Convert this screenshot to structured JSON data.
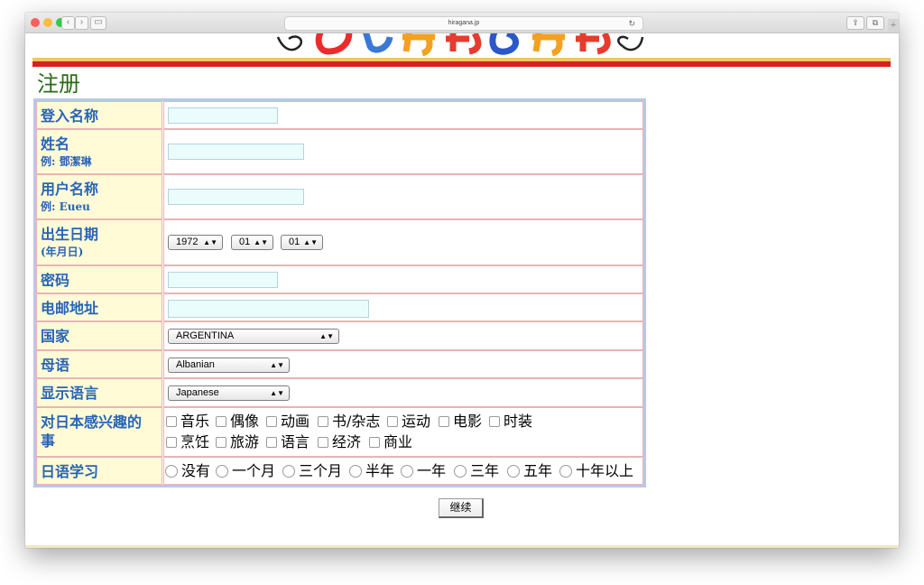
{
  "browser": {
    "url": "hiragana.jp"
  },
  "page": {
    "title": "注册"
  },
  "form": {
    "rows": [
      {
        "label": "登入名称"
      },
      {
        "label": "姓名",
        "sub": "例: 鄧潔琳"
      },
      {
        "label": "用户名称",
        "sub": "例: Eueu"
      },
      {
        "label": "出生日期",
        "sub": "(年月日)"
      },
      {
        "label": "密码"
      },
      {
        "label": "电邮地址"
      },
      {
        "label": "国家"
      },
      {
        "label": "母语"
      },
      {
        "label": "显示语言"
      },
      {
        "label": "对日本感兴趣的事"
      },
      {
        "label": "日语学习"
      }
    ],
    "birth": {
      "year": "1972",
      "month": "01",
      "day": "01"
    },
    "country": "ARGENTINA",
    "native_language": "Albanian",
    "display_language": "Japanese",
    "interests_row1": [
      "音乐",
      "偶像",
      "动画",
      "书/杂志",
      "运动",
      "电影",
      "时装"
    ],
    "interests_row2": [
      "烹饪",
      "旅游",
      "语言",
      "经济",
      "商业"
    ],
    "study": [
      "没有",
      "一个月",
      "三个月",
      "半年",
      "一年",
      "三年",
      "五年",
      "十年以上"
    ]
  },
  "submit_label": "继续",
  "colors": {
    "label_text": "#2864b6",
    "title": "#2c6b19",
    "red_bar": "#d4221e",
    "label_bg": "#fffbd7"
  }
}
